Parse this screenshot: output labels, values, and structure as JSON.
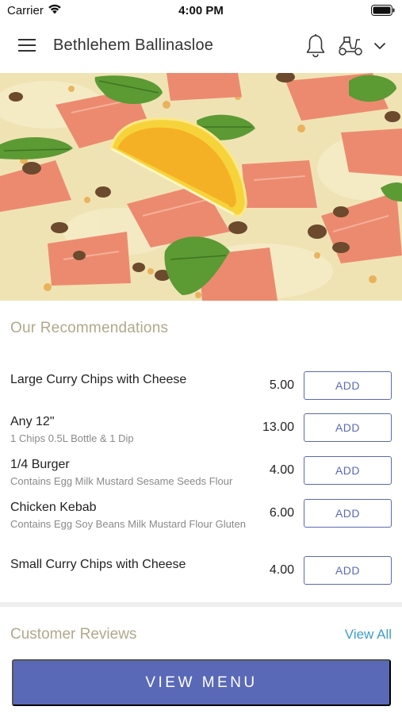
{
  "status_bar": {
    "carrier": "Carrier",
    "time": "4:00 PM"
  },
  "header": {
    "title": "Bethlehem Ballinasloe"
  },
  "recommendations": {
    "title": "Our Recommendations",
    "items": [
      {
        "name": "Large Curry Chips with Cheese",
        "description": "",
        "price": "5.00",
        "button": "ADD"
      },
      {
        "name": "Any 12\"",
        "description": "1 Chips 0.5L Bottle & 1 Dip",
        "price": "13.00",
        "button": "ADD"
      },
      {
        "name": "1/4 Burger",
        "description": "Contains Egg Milk Mustard Sesame Seeds Flour",
        "price": "4.00",
        "button": "ADD"
      },
      {
        "name": "Chicken Kebab",
        "description": "Contains Egg Soy Beans Milk Mustard Flour Gluten",
        "price": "6.00",
        "button": "ADD"
      },
      {
        "name": "Small Curry Chips with Cheese",
        "description": "",
        "price": "4.00",
        "button": "ADD"
      }
    ]
  },
  "reviews": {
    "title": "Customer Reviews",
    "view_all": "View All"
  },
  "cta": {
    "label": "VIEW MENU"
  },
  "colors": {
    "accent": "#5a69b7",
    "section_title": "#b1a88c",
    "link": "#3c9dc9"
  },
  "icons": [
    "wifi-icon",
    "battery-icon",
    "hamburger-menu-icon",
    "bell-icon",
    "scooter-icon",
    "chevron-down-icon"
  ]
}
